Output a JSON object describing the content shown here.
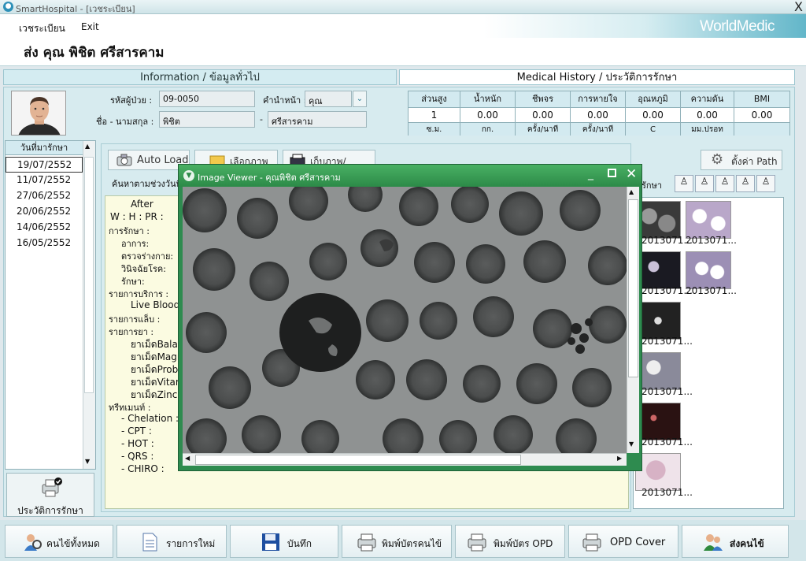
{
  "window": {
    "title": "SmartHospital - [เวชระเบียน]",
    "close": "X"
  },
  "menu": {
    "items": [
      "เวชระเบียน",
      "Exit"
    ],
    "brand": "WorldMedic"
  },
  "patient": {
    "name": "ส่ง คุณ พิชิต ศรีสารคาม"
  },
  "tabs": {
    "info": "Information / ข้อมูลทั่วไป",
    "history": "Medical History / ประวัติการรักษา"
  },
  "form": {
    "hn_label": "รหัสผู้ป่วย :",
    "hn_value": "09-0050",
    "prefix_label": "คำนำหน้า :",
    "prefix_value": "คุณ",
    "name_label": "ชื่อ - นามสกุล :",
    "first_name": "พิชิต",
    "dash": "-",
    "last_name": "ศรีสารคาม"
  },
  "vitals": {
    "headers": [
      "ส่วนสูง",
      "น้ำหนัก",
      "ชีพจร",
      "การหายใจ",
      "อุณหภูมิ",
      "ความดัน",
      "BMI"
    ],
    "values": [
      "1",
      "0.00",
      "0.00",
      "0.00",
      "0.00",
      "0.00",
      "0.00"
    ],
    "units": [
      "ซ.ม.",
      "กก.",
      "ครั้ง/นาที",
      "ครั้ง/นาที",
      "C",
      "มม.ปรอท",
      ""
    ]
  },
  "dates": {
    "header": "วันที่มารักษา",
    "items": [
      "19/07/2552",
      "11/07/2552",
      "27/06/2552",
      "20/06/2552",
      "14/06/2552",
      "16/05/2552"
    ]
  },
  "history_button": {
    "label": "ประวัติการรักษา"
  },
  "toolbar": {
    "auto_load": "Auto Load",
    "select_image": "เลือกภาพ",
    "save_image": "เก็บภาพ/เอกสาร",
    "set_path": "ตั้งค่า Path",
    "search_label": "ค้นหาตามช่วงวันที่",
    "treat_label": "รักษา"
  },
  "notes": {
    "lines": [
      "After",
      "W :   H :   PR :",
      "การรักษา  :",
      "อาการ:",
      "ตรวจร่างกาย:",
      "วินิจฉัยโรค:",
      "รักษา:",
      "รายการบริการ  :",
      "Live Blood",
      "รายการแล็บ  :",
      "รายการยา  :",
      "ยาเม็ดBalan",
      "ยาเม็ดMagn",
      "ยาเม็ดProbi",
      "ยาเม็ดVitam",
      "ยาเม็ดZinc C",
      "ทรีทเมนท์  :",
      "- Chelation  :",
      "- CPT  :",
      "- HOT  :",
      "- QRS  :",
      "- CHIRO  :"
    ]
  },
  "thumbnails": {
    "caption": "2013071...",
    "count_left": 6,
    "count_right": 2
  },
  "viewer": {
    "title": "Image Viewer - คุณพิชิต ศรีสารคาม"
  },
  "bottom": {
    "buttons": [
      "คนไข้ทั้งหมด",
      "รายการใหม่",
      "บันทึก",
      "พิมพ์บัตรคนไข้",
      "พิมพ์บัตร OPD",
      "OPD Cover",
      "ส่งคนไข้"
    ]
  }
}
